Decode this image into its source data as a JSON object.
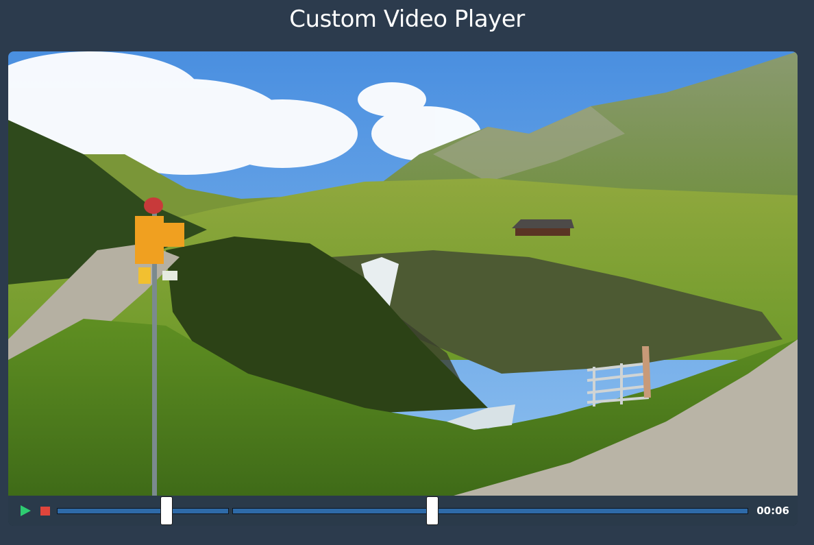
{
  "page": {
    "title": "Custom Video Player"
  },
  "player": {
    "controls": {
      "play_icon": "play-icon",
      "stop_icon": "stop-icon",
      "progress_fraction": 0.62,
      "volume_fraction": 0.54,
      "time": "00:06"
    }
  },
  "colors": {
    "background": "#2c3b4d",
    "controls_bar": "#2a3a4a",
    "track": "#2e6aa8",
    "play": "#2ecc71",
    "stop": "#e0453c"
  }
}
